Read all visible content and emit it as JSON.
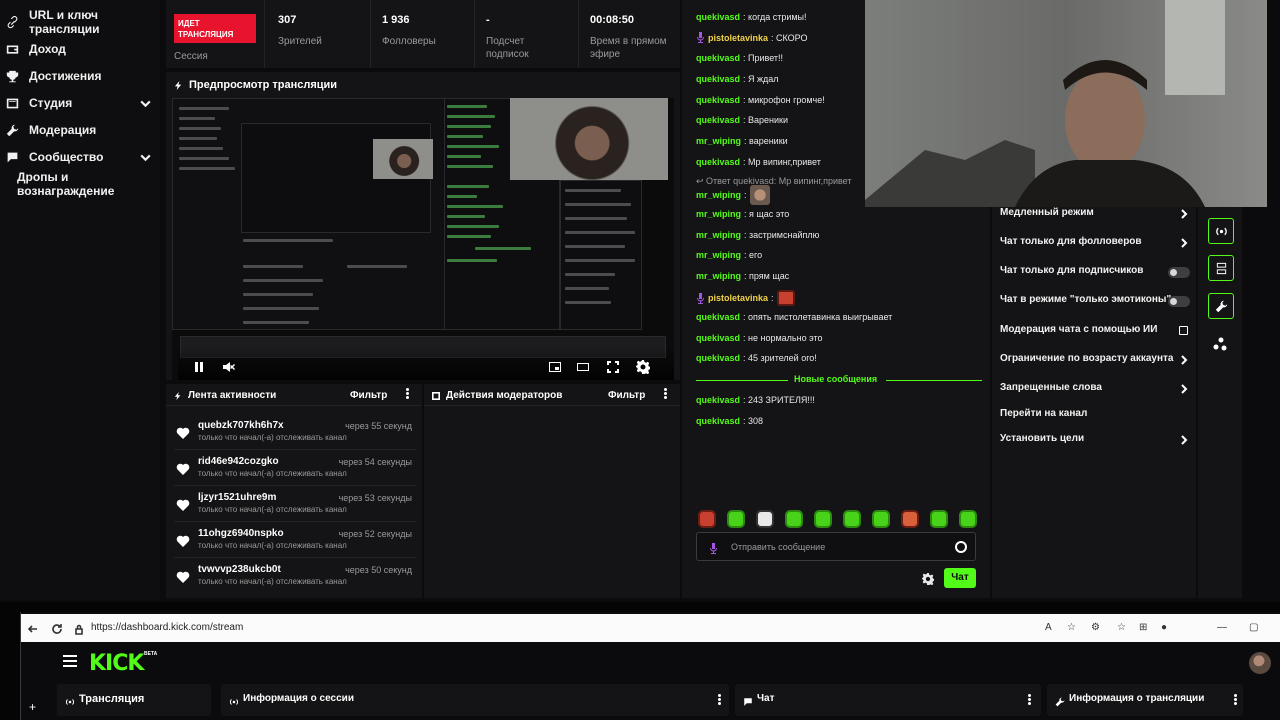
{
  "sidebar": {
    "items": [
      {
        "label": "URL и ключ трансляции",
        "icon": "link-icon"
      },
      {
        "label": "Доход",
        "icon": "wallet-icon"
      },
      {
        "label": "Достижения",
        "icon": "trophy-icon"
      },
      {
        "label": "Студия",
        "icon": "studio-icon"
      },
      {
        "label": "Модерация",
        "icon": "wrench-icon"
      },
      {
        "label": "Сообщество",
        "icon": "community-icon"
      },
      {
        "label": "Дропы и вознаграждение",
        "icon": ""
      }
    ]
  },
  "session": {
    "live_badge": "ИДЕТ ТРАНСЛЯЦИЯ",
    "session_label": "Сессия",
    "stats": [
      {
        "value": "307",
        "label": "Зрителей"
      },
      {
        "value": "1 936",
        "label": "Фолловеры"
      },
      {
        "value": "-",
        "label": "Подсчет подписок"
      },
      {
        "value": "00:08:50",
        "label": "Время в прямом эфире"
      }
    ]
  },
  "preview": {
    "title": "Предпросмотр трансляции"
  },
  "activity": {
    "title": "Лента активности",
    "filter": "Фильтр",
    "items": [
      {
        "name": "quebzk707kh6h7x",
        "time": "через 55 секунд",
        "desc": "только что начал(-а) отслеживать канал"
      },
      {
        "name": "rid46e942cozgko",
        "time": "через 54 секунды",
        "desc": "только что начал(-а) отслеживать канал"
      },
      {
        "name": "ljzyr1521uhre9m",
        "time": "через 53 секунды",
        "desc": "только что начал(-а) отслеживать канал"
      },
      {
        "name": "11ohgz6940nspko",
        "time": "через 52 секунды",
        "desc": "только что начал(-а) отслеживать канал"
      },
      {
        "name": "tvwvvp238ukcb0t",
        "time": "через 50 секунд",
        "desc": "только что начал(-а) отслеживать канал"
      }
    ]
  },
  "moderators": {
    "title": "Действия модераторов",
    "filter": "Фильтр"
  },
  "chat": {
    "messages": [
      {
        "user": "quekivasd",
        "color": "#53fc18",
        "text": ": когда стримы!"
      },
      {
        "user": "pistoletavinka",
        "color": "#f0d24a",
        "text": ": СКОРО",
        "mic": true
      },
      {
        "user": "quekivasd",
        "color": "#53fc18",
        "text": ": Привет!!"
      },
      {
        "user": "quekivasd",
        "color": "#53fc18",
        "text": ": Я ждал"
      },
      {
        "user": "quekivasd",
        "color": "#53fc18",
        "text": ": микрофон громче!"
      },
      {
        "user": "quekivasd",
        "color": "#53fc18",
        "text": ": Вареники"
      },
      {
        "user": "mr_wiping",
        "color": "#53fc18",
        "text": ": вареники"
      },
      {
        "user": "quekivasd",
        "color": "#53fc18",
        "text": ": Мр випинг,привет"
      }
    ],
    "reply_note": "Ответ quekivasd: Мр випинг,привет",
    "messages2": [
      {
        "user": "mr_wiping",
        "color": "#53fc18",
        "text": ":"
      },
      {
        "user": "mr_wiping",
        "color": "#53fc18",
        "text": ": я щас это"
      },
      {
        "user": "mr_wiping",
        "color": "#53fc18",
        "text": ": застримснайплю"
      },
      {
        "user": "mr_wiping",
        "color": "#53fc18",
        "text": ": его"
      },
      {
        "user": "mr_wiping",
        "color": "#53fc18",
        "text": ": прям щас"
      },
      {
        "user": "pistoletavinka",
        "color": "#f0d24a",
        "text": ":",
        "mic": true
      },
      {
        "user": "quekivasd",
        "color": "#53fc18",
        "text": ": опять пистолетавинка выигрывает"
      },
      {
        "user": "quekivasd",
        "color": "#53fc18",
        "text": ": не нормально это"
      },
      {
        "user": "quekivasd",
        "color": "#53fc18",
        "text": ": 45 зрителей ого!"
      }
    ],
    "new_messages_label": "Новые сообщения",
    "messages3": [
      {
        "user": "quekivasd",
        "color": "#53fc18",
        "text": ": 243 ЗРИТЕЛЯ!!!"
      },
      {
        "user": "quekivasd",
        "color": "#53fc18",
        "text": ": 308"
      }
    ],
    "input_placeholder": "Отправить сообщение",
    "send_label": "Чат"
  },
  "settings": {
    "rows": [
      {
        "label": "Медленный режим",
        "control": "chevron"
      },
      {
        "label": "Чат только для фолловеров",
        "control": "chevron"
      },
      {
        "label": "Чат только для подписчиков",
        "control": "toggle"
      },
      {
        "label": "Чат в режиме \"только эмотиконы\"",
        "control": "toggle"
      },
      {
        "label": "Модерация чата с помощью ИИ",
        "control": "external"
      },
      {
        "label": "Ограничение по возрасту аккаунта",
        "control": "chevron"
      },
      {
        "label": "Запрещенные слова",
        "control": "chevron"
      },
      {
        "label": "Перейти на канал",
        "control": "none"
      },
      {
        "label": "Установить цели",
        "control": "chevron"
      }
    ]
  },
  "browser": {
    "url": "https://dashboard.kick.com/stream",
    "logo": "KICK",
    "beta": "BETA",
    "tabs": [
      {
        "label": "Трансляция"
      },
      {
        "label": "Информация о сессии"
      },
      {
        "label": "Чат"
      },
      {
        "label": "Информация о трансляции"
      }
    ],
    "leftrail_plus": "+"
  },
  "colors": {
    "accent": "#53fc18",
    "live": "#e8142e",
    "panel": "#141416",
    "bg": "#0b0b0d"
  }
}
